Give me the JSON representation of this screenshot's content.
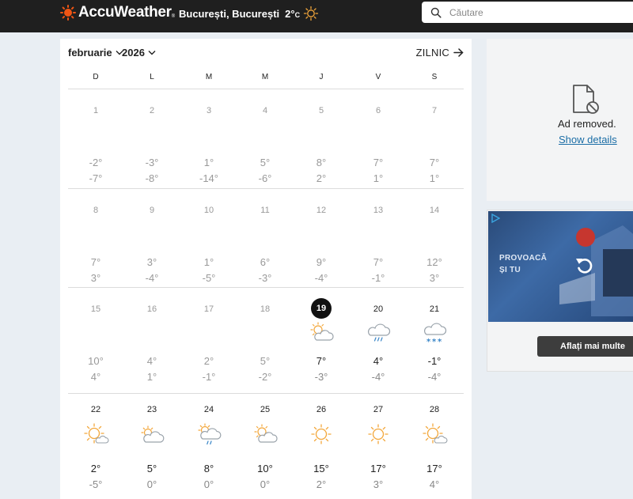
{
  "header": {
    "brand": "AccuWeather",
    "brand_tm": "®",
    "location": "București, București",
    "current_temp": "2°",
    "current_unit": "C",
    "current_icon": "sunny-icon",
    "search_placeholder": "Căutare"
  },
  "calendar": {
    "month": "februarie",
    "year": "2026",
    "view_label": "ZILNIC",
    "weekdays": [
      "D",
      "L",
      "M",
      "M",
      "J",
      "V",
      "S"
    ],
    "today": "19",
    "weeks": [
      [
        {
          "day": "1",
          "hi": "-2°",
          "lo": "-7°",
          "icon": "",
          "active": false
        },
        {
          "day": "2",
          "hi": "-3°",
          "lo": "-8°",
          "icon": "",
          "active": false
        },
        {
          "day": "3",
          "hi": "1°",
          "lo": "-14°",
          "icon": "",
          "active": false
        },
        {
          "day": "4",
          "hi": "5°",
          "lo": "-6°",
          "icon": "",
          "active": false
        },
        {
          "day": "5",
          "hi": "8°",
          "lo": "2°",
          "icon": "",
          "active": false
        },
        {
          "day": "6",
          "hi": "7°",
          "lo": "1°",
          "icon": "",
          "active": false
        },
        {
          "day": "7",
          "hi": "7°",
          "lo": "1°",
          "icon": "",
          "active": false
        }
      ],
      [
        {
          "day": "8",
          "hi": "7°",
          "lo": "3°",
          "icon": "",
          "active": false
        },
        {
          "day": "9",
          "hi": "3°",
          "lo": "-4°",
          "icon": "",
          "active": false
        },
        {
          "day": "10",
          "hi": "1°",
          "lo": "-5°",
          "icon": "",
          "active": false
        },
        {
          "day": "11",
          "hi": "6°",
          "lo": "-3°",
          "icon": "",
          "active": false
        },
        {
          "day": "12",
          "hi": "9°",
          "lo": "-4°",
          "icon": "",
          "active": false
        },
        {
          "day": "13",
          "hi": "7°",
          "lo": "-1°",
          "icon": "",
          "active": false
        },
        {
          "day": "14",
          "hi": "12°",
          "lo": "3°",
          "icon": "",
          "active": false
        }
      ],
      [
        {
          "day": "15",
          "hi": "10°",
          "lo": "4°",
          "icon": "",
          "active": false
        },
        {
          "day": "16",
          "hi": "4°",
          "lo": "1°",
          "icon": "",
          "active": false
        },
        {
          "day": "17",
          "hi": "2°",
          "lo": "-1°",
          "icon": "",
          "active": false
        },
        {
          "day": "18",
          "hi": "5°",
          "lo": "-2°",
          "icon": "",
          "active": false
        },
        {
          "day": "19",
          "hi": "7°",
          "lo": "-3°",
          "icon": "partly-sunny-icon",
          "active": true
        },
        {
          "day": "20",
          "hi": "4°",
          "lo": "-4°",
          "icon": "rain-cloud-icon",
          "active": true
        },
        {
          "day": "21",
          "hi": "-1°",
          "lo": "-4°",
          "icon": "snow-cloud-icon",
          "active": true
        }
      ],
      [
        {
          "day": "22",
          "hi": "2°",
          "lo": "-5°",
          "icon": "sun-small-cloud-icon",
          "active": true
        },
        {
          "day": "23",
          "hi": "5°",
          "lo": "0°",
          "icon": "mostly-cloudy-icon",
          "active": true
        },
        {
          "day": "24",
          "hi": "8°",
          "lo": "0°",
          "icon": "sun-shower-icon",
          "active": true
        },
        {
          "day": "25",
          "hi": "10°",
          "lo": "0°",
          "icon": "partly-sunny-icon",
          "active": true
        },
        {
          "day": "26",
          "hi": "15°",
          "lo": "2°",
          "icon": "sunny-icon",
          "active": true
        },
        {
          "day": "27",
          "hi": "17°",
          "lo": "3°",
          "icon": "sunny-icon",
          "active": true
        },
        {
          "day": "28",
          "hi": "17°",
          "lo": "4°",
          "icon": "sun-small-cloud-icon",
          "active": true
        }
      ]
    ]
  },
  "sidebar": {
    "ad_removed_text": "Ad removed.",
    "show_details": "Show details",
    "ad_slogan_line1": "PROVOACĂ",
    "ad_slogan_line2": "ȘI TU",
    "ad_cta": "Aflați mai multe"
  },
  "colors": {
    "header_bg": "#1f1f1f",
    "accent_orange": "#f05514",
    "sun_yellow": "#f3a73b",
    "cloud_gray": "#9aa3ab",
    "rain_blue": "#3a86c8",
    "today_bg": "#111111",
    "link_blue": "#1a6da6"
  }
}
